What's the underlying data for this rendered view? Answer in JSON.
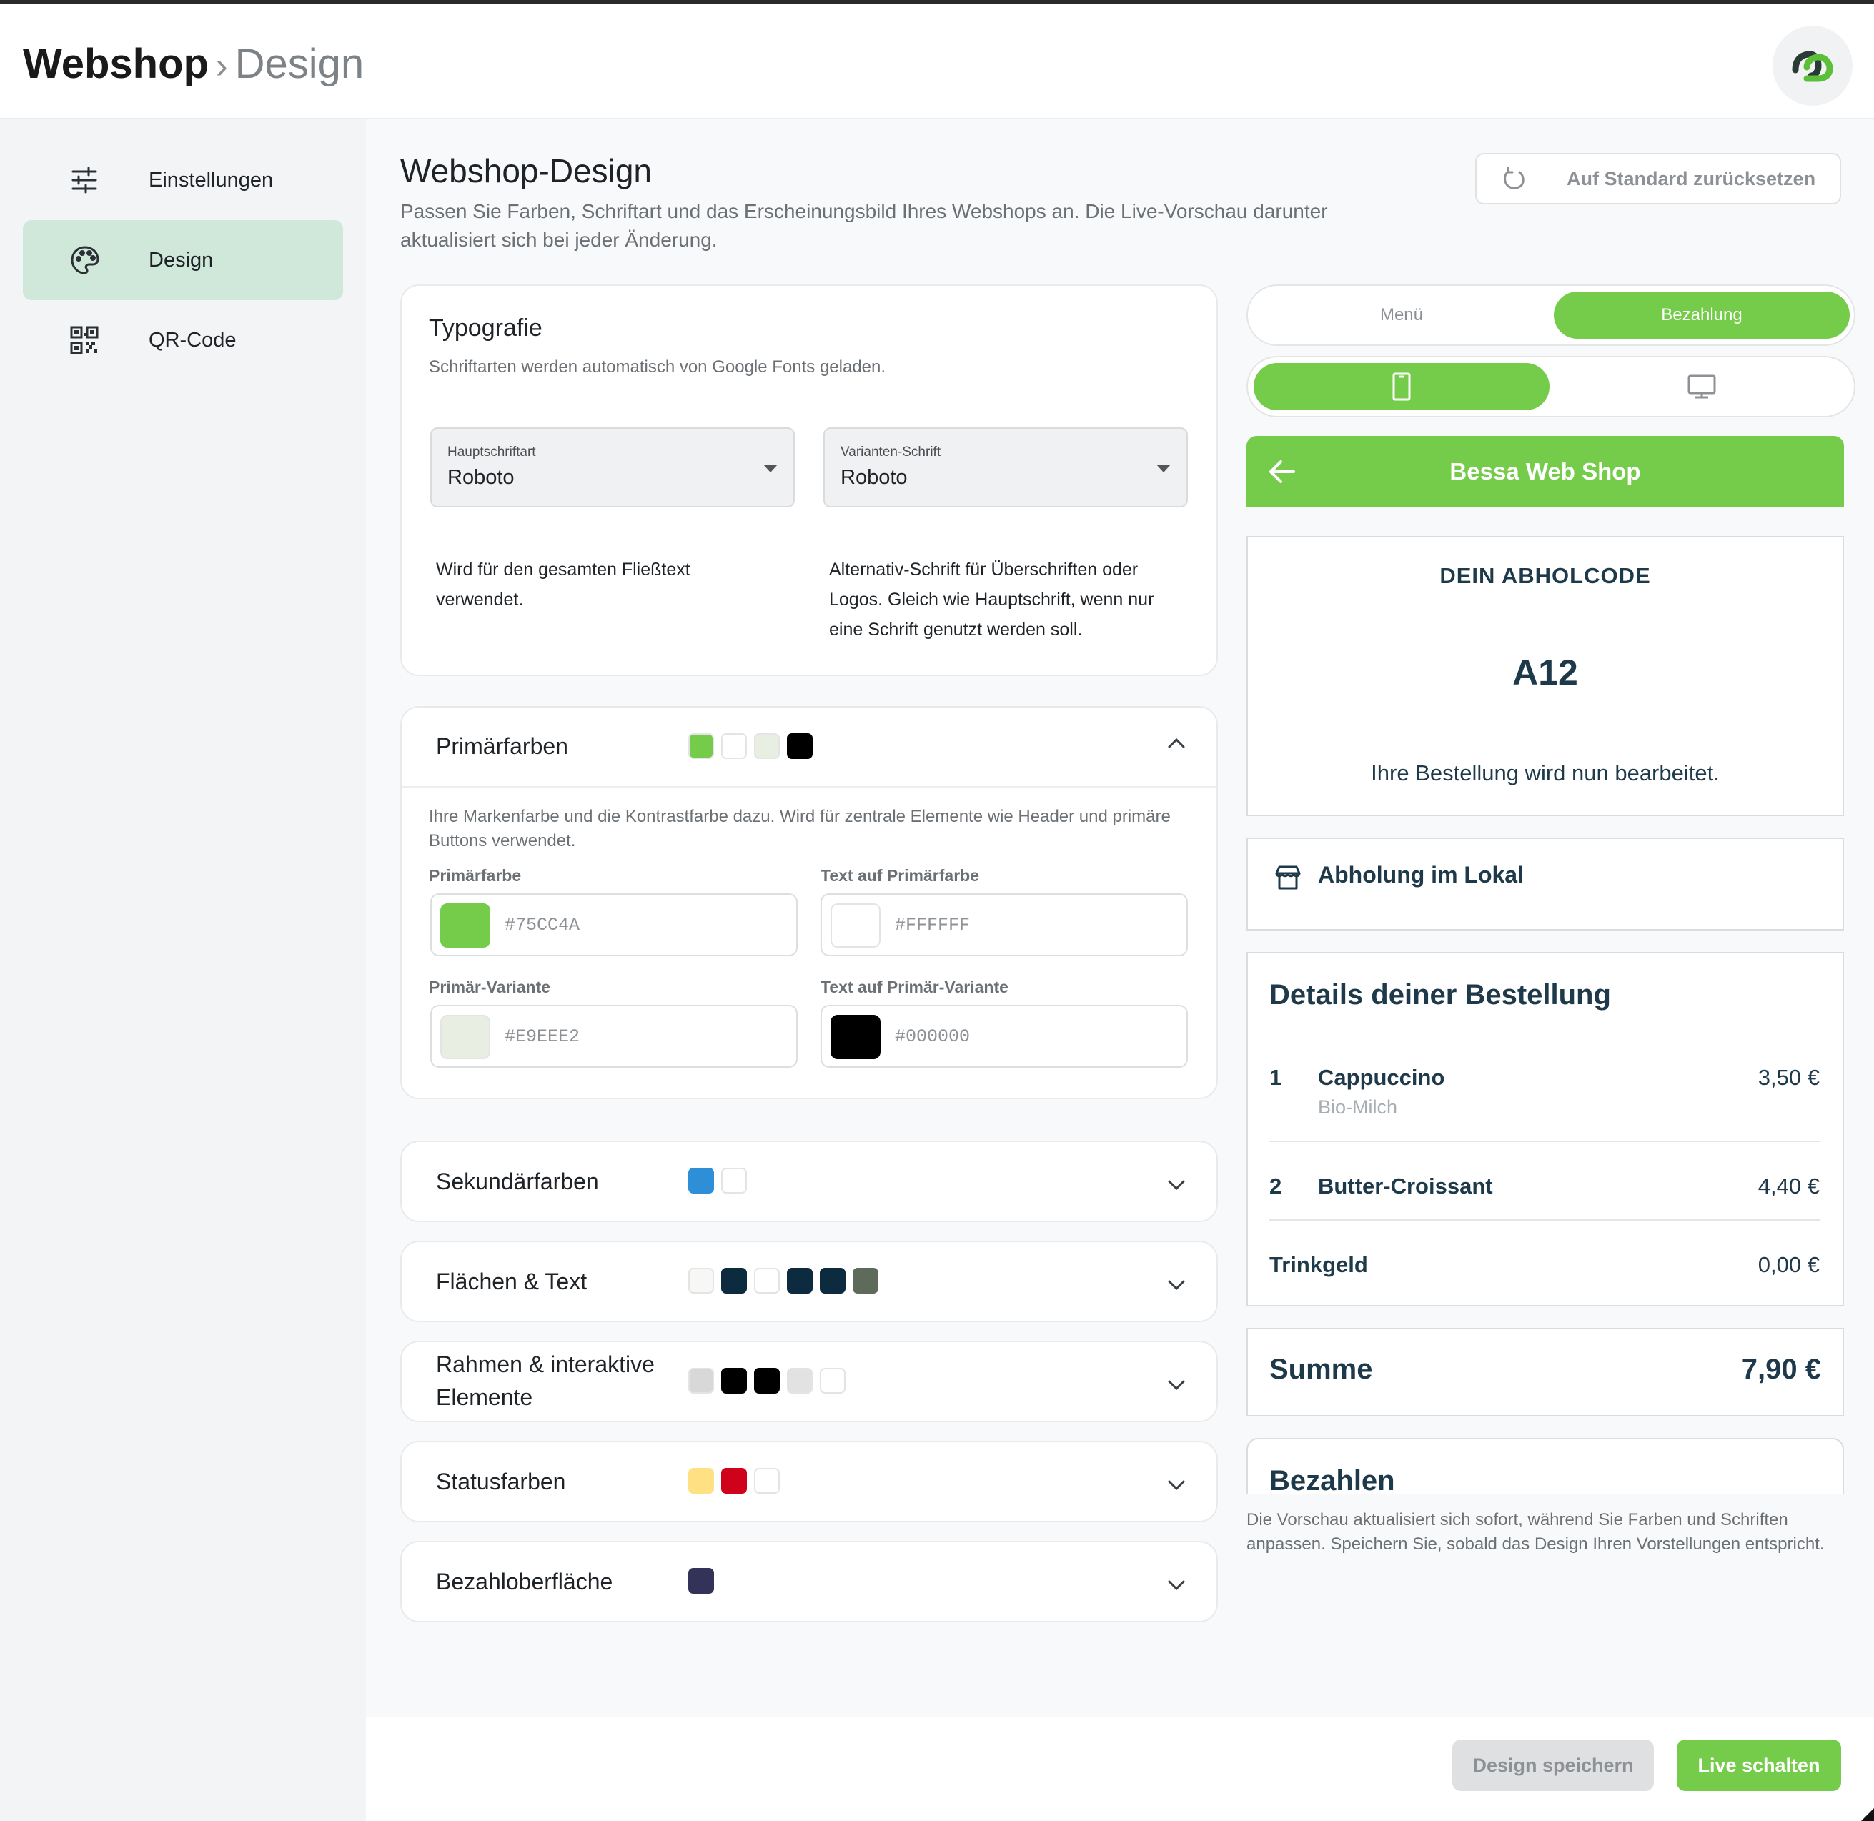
{
  "header": {
    "brand": "Webshop",
    "separator": "›",
    "section": "Design"
  },
  "sidebar": {
    "items": [
      {
        "label": "Einstellungen",
        "icon": "sliders-icon",
        "active": false
      },
      {
        "label": "Design",
        "icon": "palette-icon",
        "active": true
      },
      {
        "label": "QR-Code",
        "icon": "qr-code-icon",
        "active": false
      }
    ]
  },
  "page": {
    "title": "Webshop-Design",
    "description": "Passen Sie Farben, Schriftart und das Erscheinungsbild Ihres Webshops an. Die Live-Vorschau darunter aktualisiert sich bei jeder Änderung.",
    "reset_label": "Auf Standard zurücksetzen"
  },
  "typography": {
    "title": "Typografie",
    "subtitle": "Schriftarten werden automatisch von Google Fonts geladen.",
    "main_font": {
      "label": "Hauptschriftart",
      "value": "Roboto",
      "help": "Wird für den gesamten Fließtext verwendet."
    },
    "variant_font": {
      "label": "Varianten-Schrift",
      "value": "Roboto",
      "help": "Alternativ-Schrift für Überschriften oder Logos. Gleich wie Hauptschrift, wenn nur eine Schrift genutzt werden soll."
    }
  },
  "primary": {
    "title": "Primärfarben",
    "swatches": [
      "#75CC4A",
      "#FFFFFF",
      "#E9EEE2",
      "#000000"
    ],
    "expanded": true,
    "description": "Ihre Markenfarbe und die Kontrastfarbe dazu. Wird für zentrale Elemente wie Header und primäre Buttons verwendet.",
    "fields": [
      {
        "label": "Primärfarbe",
        "value": "#75CC4A"
      },
      {
        "label": "Text auf Primärfarbe",
        "value": "#FFFFFF"
      },
      {
        "label": "Primär-Variante",
        "value": "#E9EEE2"
      },
      {
        "label": "Text auf Primär-Variante",
        "value": "#000000"
      }
    ]
  },
  "accordions": [
    {
      "title": "Sekundärfarben",
      "swatches": [
        "#2E8FD8",
        "#FFFFFF"
      ]
    },
    {
      "title": "Flächen & Text",
      "swatches": [
        "#F7F7F5",
        "#0D2B3E",
        "#FFFFFF",
        "#0D2B3E",
        "#0D2B3E",
        "#5E6B5A"
      ]
    },
    {
      "title": "Rahmen & interaktive Elemente",
      "swatches": [
        "#D8D8D8",
        "#000000",
        "#000000",
        "#E2E2E2",
        "#FFFFFF"
      ]
    },
    {
      "title": "Statusfarben",
      "swatches": [
        "#FFE082",
        "#D0021B",
        "#FFFFFF"
      ]
    },
    {
      "title": "Bezahloberfläche",
      "swatches": [
        "#33335A"
      ]
    }
  ],
  "preview": {
    "tabs": [
      {
        "label": "Menü",
        "active": false
      },
      {
        "label": "Bezahlung",
        "active": true
      }
    ],
    "device": {
      "mobile_icon": "smartphone-icon",
      "desktop_icon": "monitor-icon",
      "active": "mobile"
    },
    "shop_title": "Bessa Web Shop",
    "pickup": {
      "title": "DEIN ABHOLCODE",
      "code": "A12",
      "note": "Ihre Bestellung wird nun bearbeitet."
    },
    "delivery": "Abholung im Lokal",
    "details_title": "Details deiner Bestellung",
    "items": [
      {
        "qty": "1",
        "name": "Cappuccino",
        "sub": "Bio-Milch",
        "price": "3,50 €"
      },
      {
        "qty": "2",
        "name": "Butter-Croissant",
        "sub": "",
        "price": "4,40 €"
      }
    ],
    "tip": {
      "label": "Trinkgeld",
      "price": "0,00 €"
    },
    "sum": {
      "label": "Summe",
      "price": "7,90 €"
    },
    "pay_title": "Bezahlen",
    "note": "Die Vorschau aktualisiert sich sofort, während Sie Farben und Schriften anpassen. Speichern Sie, sobald das Design Ihren Vorstellungen entspricht."
  },
  "footer": {
    "save_label": "Design speichern",
    "live_label": "Live schalten"
  },
  "colors": {
    "accent": "#75CC4A",
    "nav_active": "#CFE8DA",
    "preview_text": "#1E3A4A"
  }
}
